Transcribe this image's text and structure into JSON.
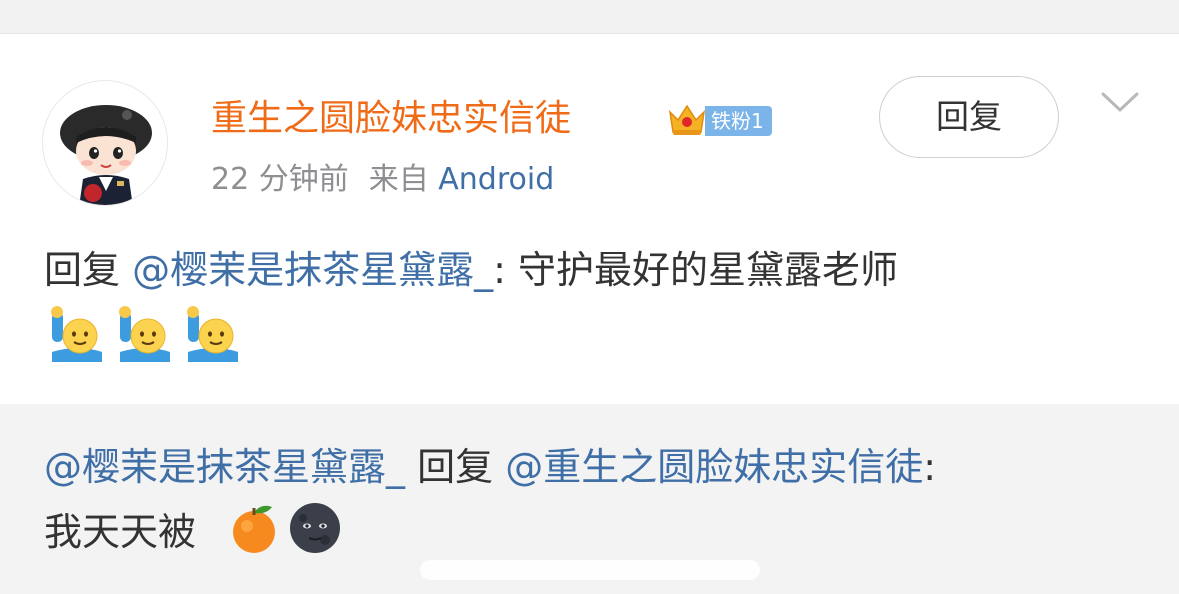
{
  "comment": {
    "username": "重生之圆脸妹忠实信徒",
    "fan_badge": "铁粉1",
    "time": "22 分钟前",
    "source_prefix": "来自",
    "source": "Android",
    "reply_button": "回复",
    "text_prefix": "回复 ",
    "mention": "@樱茉是抹茶星黛露_",
    "text_body": ": 守护最好的星黛露老师",
    "emojis": [
      "raising-hand-emoji",
      "raising-hand-emoji",
      "raising-hand-emoji"
    ]
  },
  "quoted_reply": {
    "from_mention": "@樱茉是抹茶星黛露_",
    "reply_word": " 回复 ",
    "to_mention": "@重生之圆脸妹忠实信徒",
    "colon": ":",
    "text": "我天天被",
    "emojis": [
      "tangerine-emoji",
      "new-moon-face-emoji"
    ]
  },
  "colors": {
    "username": "#f06b17",
    "mention": "#3f6fa6",
    "fan_badge": "#7ab4e8",
    "quote_bg": "#f3f3f3"
  }
}
